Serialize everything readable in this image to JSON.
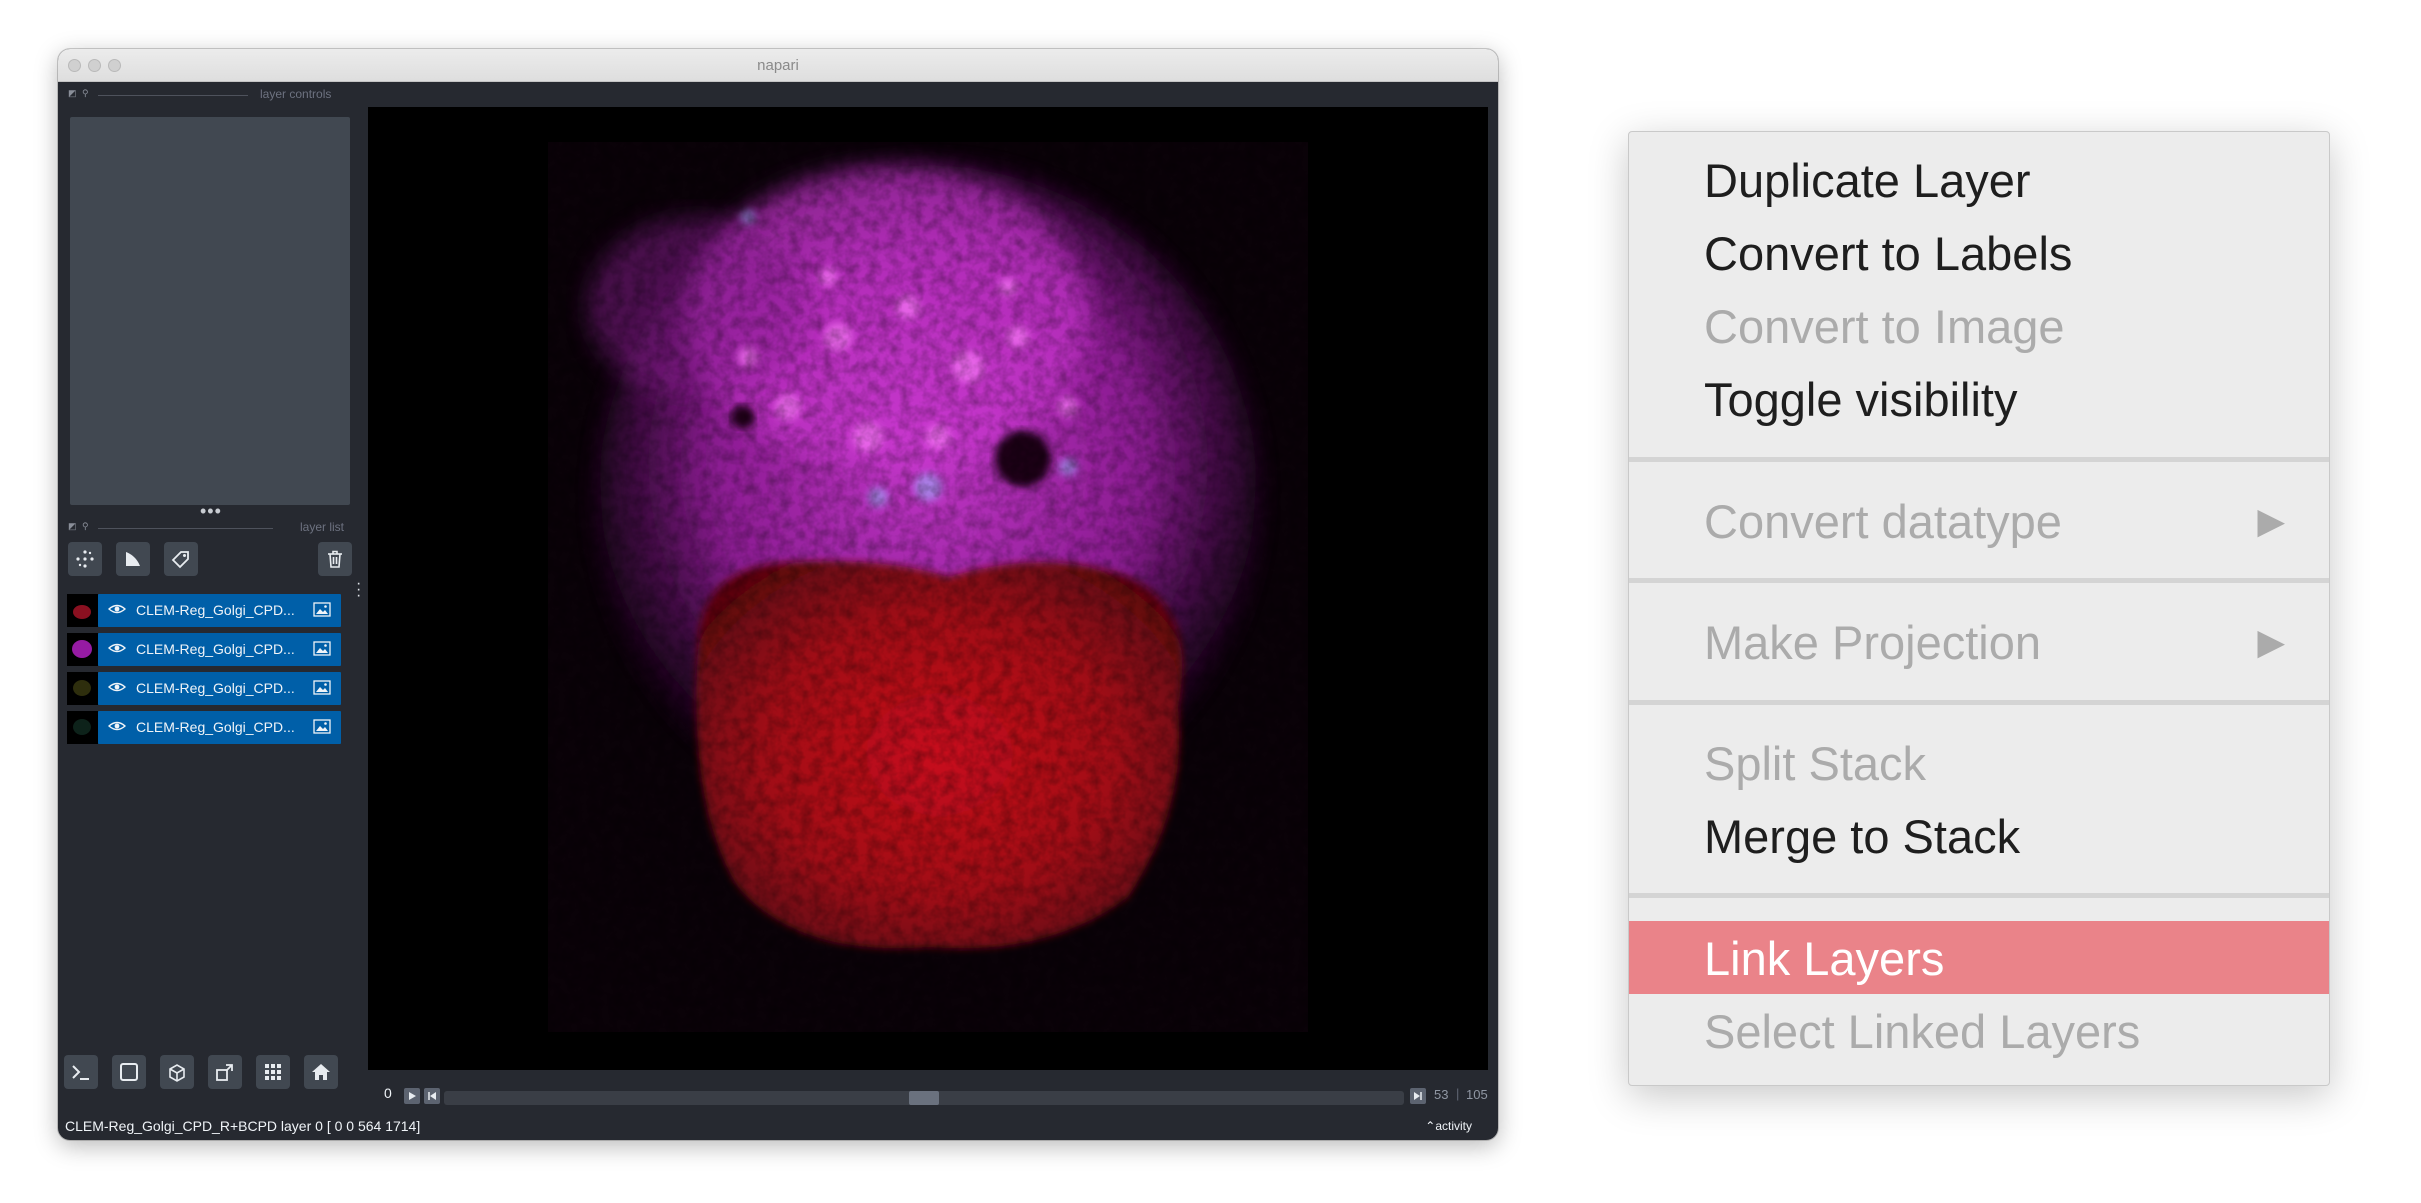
{
  "window": {
    "title": "napari"
  },
  "layer_controls": {
    "label": "layer controls"
  },
  "layer_list": {
    "label": "layer list",
    "layers": [
      {
        "name": "CLEM-Reg_Golgi_CPD...",
        "thumb_color": "#8a1020"
      },
      {
        "name": "CLEM-Reg_Golgi_CPD...",
        "thumb_color": "#b020c0"
      },
      {
        "name": "CLEM-Reg_Golgi_CPD...",
        "thumb_color": "#3a3a10"
      },
      {
        "name": "CLEM-Reg_Golgi_CPD...",
        "thumb_color": "#102a20"
      }
    ]
  },
  "toolbar_icons": [
    "points-icon",
    "shapes-icon",
    "labels-icon",
    "delete-icon"
  ],
  "bottom_icons": [
    "console-icon",
    "ndisplay-icon",
    "roll-icon",
    "transpose-icon",
    "grid-icon",
    "home-icon"
  ],
  "dims_slider": {
    "start_label": "0",
    "current": "53",
    "max": "105",
    "position_fraction": 0.5
  },
  "status": {
    "text": "CLEM-Reg_Golgi_CPD_R+BCPD layer 0 [   0    0  564 1714]",
    "activity_label": "activity"
  },
  "colors": {
    "menu_highlight": "#ea8389",
    "layer_selected": "#005fa8",
    "panel_bg": "#262930"
  },
  "context_menu": {
    "items": [
      {
        "label": "Duplicate Layer",
        "enabled": true
      },
      {
        "label": "Convert to Labels",
        "enabled": true
      },
      {
        "label": "Convert to Image",
        "enabled": false
      },
      {
        "label": "Toggle visibility",
        "enabled": true
      },
      {
        "label": "Convert datatype",
        "enabled": false,
        "submenu": true
      },
      {
        "label": "Make Projection",
        "enabled": false,
        "submenu": true
      },
      {
        "label": "Split Stack",
        "enabled": false
      },
      {
        "label": "Merge to Stack",
        "enabled": true
      },
      {
        "label": "Link Layers",
        "enabled": true,
        "highlighted": true
      },
      {
        "label": "Select Linked Layers",
        "enabled": false
      }
    ]
  }
}
